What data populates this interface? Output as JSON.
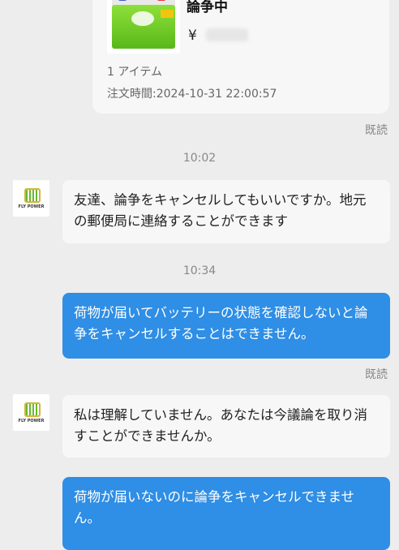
{
  "order": {
    "status": "論争中",
    "currency_symbol": "¥",
    "item_count": "1 アイテム",
    "order_time": "注文時間:2024-10-31 22:00:57"
  },
  "messages": [
    {
      "type": "status",
      "text": "既読"
    },
    {
      "type": "time",
      "text": "10:02"
    },
    {
      "type": "received",
      "text": "友達、論争をキャンセルしてもいいですか。地元の郵便局に連絡することができます"
    },
    {
      "type": "time",
      "text": "10:34"
    },
    {
      "type": "sent",
      "text": "荷物が届いてバッテリーの状態を確認しないと論争をキャンセルすることはできません。"
    },
    {
      "type": "status",
      "text": "既読"
    },
    {
      "type": "received",
      "text": "私は理解していません。あなたは今議論を取り消すことができませんか。"
    },
    {
      "type": "sent",
      "text": "荷物が届いないのに論争をキャンセルできません。"
    }
  ],
  "avatar_logo_text": "FLY POWER",
  "colors": {
    "sent_bubble": "#2f8ee5",
    "received_bubble": "#f7f7f7",
    "background": "#ededed"
  }
}
